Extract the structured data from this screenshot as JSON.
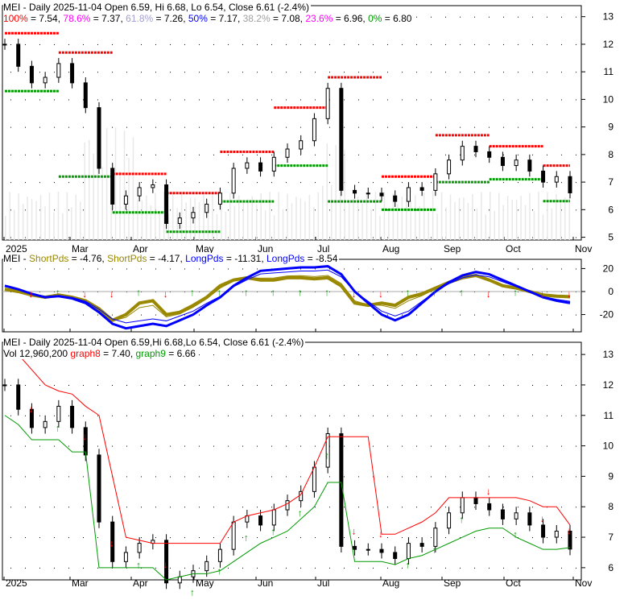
{
  "chart_data": [
    {
      "type": "candlestick",
      "title": "MEI - Daily 2025-11-04 Open 6.59, Hi 6.68, Lo 6.54, Close 6.61 (-2.4%)",
      "fib_levels": [
        {
          "label": "100%",
          "value": "7.54",
          "color": "#ff0000"
        },
        {
          "label": "78.6%",
          "value": "7.37",
          "color": "#ff00ff"
        },
        {
          "label": "61.8%",
          "value": "7.26",
          "color": "#a0a0d0"
        },
        {
          "label": "50%",
          "value": "7.17",
          "color": "#0000ff"
        },
        {
          "label": "38.2%",
          "value": "7.08",
          "color": "#a0a0a0"
        },
        {
          "label": "23.6%",
          "value": "6.96",
          "color": "#ff00ff"
        },
        {
          "label": "0%",
          "value": "6.80",
          "color": "#009900"
        }
      ],
      "y_ticks": [
        13,
        12,
        11,
        10,
        9,
        8,
        7,
        6,
        5
      ],
      "ylim": [
        4.9,
        13.4
      ]
    },
    {
      "type": "line",
      "title": "MEI",
      "series": [
        {
          "name": "ShortPds",
          "label": "ShortPds = -4.76",
          "color": "#998800"
        },
        {
          "name": "ShortPds",
          "label": "ShortPds = -4.17",
          "color": "#998800"
        },
        {
          "name": "LongPds",
          "label": "LongPds = -11.31",
          "color": "#0000ff"
        },
        {
          "name": "LongPds",
          "label": "LongPds = -8.54",
          "color": "#0000ff"
        }
      ],
      "y_ticks": [
        20,
        0,
        -20
      ],
      "ylim": [
        -35,
        28
      ]
    },
    {
      "type": "line",
      "title": "MEI - Daily 2025-11-04 Open 6.59,Hi 6.68,Lo 6.54, Close 6.61 (-2.4%)",
      "vol": "Vol 12,960,200",
      "graph8": "graph8",
      "graph8_val": "= 7.40,",
      "graph9": "graph9",
      "graph9_val": "= 6.66",
      "y_ticks": [
        13,
        12,
        11,
        10,
        9,
        8,
        7,
        6
      ],
      "ylim": [
        5.6,
        13.4
      ]
    }
  ],
  "x_labels": [
    "2025",
    "Mar",
    "Apr",
    "May",
    "Jun",
    "Jul",
    "Aug",
    "Sep",
    "Oct",
    "Nov"
  ],
  "weekly_close": [
    12.0,
    11.2,
    10.6,
    10.8,
    11.3,
    10.6,
    9.7,
    7.5,
    6.2,
    6.5,
    6.8,
    6.9,
    5.5,
    5.7,
    5.9,
    6.2,
    6.6,
    7.5,
    7.7,
    7.4,
    7.9,
    8.2,
    8.5,
    9.3,
    10.4,
    6.7,
    6.6,
    6.6,
    6.5,
    6.3,
    6.8,
    6.7,
    7.3,
    7.8,
    8.3,
    8.1,
    7.9,
    7.6,
    7.8,
    7.4,
    7.0,
    7.2,
    6.61
  ],
  "short_pds": [
    2,
    0,
    -3,
    -5,
    -3,
    -5,
    -8,
    -15,
    -25,
    -20,
    -10,
    -8,
    -20,
    -18,
    -12,
    -5,
    5,
    10,
    12,
    10,
    10,
    12,
    12,
    11,
    12,
    5,
    -10,
    -12,
    -10,
    -12,
    -5,
    -2,
    3,
    8,
    12,
    14,
    10,
    5,
    3,
    0,
    -3,
    -4,
    -4.5
  ],
  "long_pds": [
    5,
    2,
    -2,
    -5,
    -4,
    -6,
    -10,
    -18,
    -28,
    -32,
    -30,
    -28,
    -30,
    -25,
    -20,
    -12,
    -5,
    5,
    12,
    18,
    19,
    20,
    21,
    21,
    22,
    15,
    0,
    -10,
    -20,
    -25,
    -20,
    -10,
    0,
    8,
    14,
    17,
    15,
    10,
    5,
    0,
    -5,
    -8,
    -10
  ],
  "graph8": [
    13,
    13,
    12.5,
    12,
    11.8,
    11.7,
    11.3,
    11,
    9,
    7,
    6.9,
    6.8,
    6.8,
    6.8,
    6.8,
    6.8,
    6.8,
    7.5,
    7.7,
    7.8,
    7.9,
    8.1,
    8.4,
    9.3,
    10.3,
    10.3,
    10.3,
    10.3,
    7.1,
    7.1,
    7.3,
    7.5,
    7.8,
    8.3,
    8.3,
    8.3,
    8.3,
    8.3,
    8.3,
    8.2,
    8.0,
    8.0,
    7.4
  ],
  "graph9": [
    11,
    10.7,
    10.2,
    10.2,
    10.2,
    9.8,
    9.8,
    6.0,
    6.0,
    6.0,
    6.0,
    6.0,
    5.6,
    5.7,
    5.8,
    5.8,
    5.9,
    6.2,
    6.5,
    6.8,
    7.0,
    7.2,
    7.6,
    8.0,
    8.8,
    8.8,
    6.2,
    6.2,
    6.2,
    6.1,
    6.3,
    6.4,
    6.6,
    6.8,
    7.0,
    7.2,
    7.3,
    7.3,
    7.0,
    6.8,
    6.6,
    6.6,
    6.66
  ]
}
